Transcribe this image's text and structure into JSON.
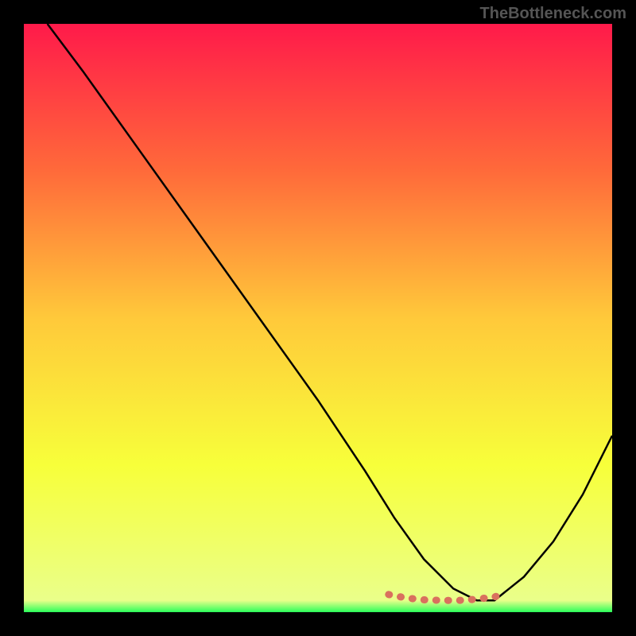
{
  "watermark": "TheBottleneck.com",
  "chart_data": {
    "type": "line",
    "title": "",
    "xlabel": "",
    "ylabel": "",
    "xlim": [
      0,
      100
    ],
    "ylim": [
      0,
      100
    ],
    "gradient_stops": [
      {
        "offset": 0,
        "color": "#ff1a4a"
      },
      {
        "offset": 25,
        "color": "#ff6a3a"
      },
      {
        "offset": 50,
        "color": "#ffc93a"
      },
      {
        "offset": 75,
        "color": "#f7ff3a"
      },
      {
        "offset": 98,
        "color": "#eaff8a"
      },
      {
        "offset": 100,
        "color": "#2aff5a"
      }
    ],
    "series": [
      {
        "name": "bottleneck-curve",
        "color": "#000000",
        "x": [
          4,
          10,
          20,
          30,
          40,
          50,
          58,
          63,
          68,
          73,
          77,
          80,
          85,
          90,
          95,
          100
        ],
        "values": [
          100,
          92,
          78,
          64,
          50,
          36,
          24,
          16,
          9,
          4,
          2,
          2,
          6,
          12,
          20,
          30
        ]
      },
      {
        "name": "optimal-range-marker",
        "color": "#d9705e",
        "x": [
          62,
          65,
          68,
          71,
          74,
          77,
          80,
          82
        ],
        "values": [
          3.0,
          2.4,
          2.1,
          2.0,
          2.0,
          2.2,
          2.6,
          3.2
        ]
      }
    ],
    "annotations": []
  }
}
